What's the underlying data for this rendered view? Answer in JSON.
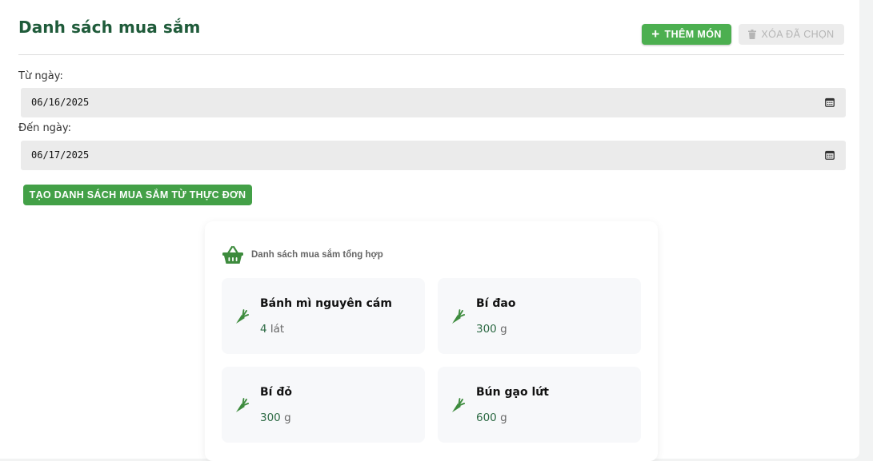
{
  "header": {
    "title": "Danh sách mua sắm",
    "add_label": "THÊM MÓN",
    "delete_label": "XÓA ĐÃ CHỌN"
  },
  "filters": {
    "from_label": "Từ ngày:",
    "from_value": "06/16/2025",
    "to_label": "Đến ngày:",
    "to_value": "06/17/2025"
  },
  "generate_label": "TẠO DANH SÁCH MUA SẮM TỪ THỰC ĐƠN",
  "summary": {
    "title": "Danh sách mua sắm tổng hợp",
    "items": [
      {
        "name": "Bánh mì nguyên cám",
        "qty": "4",
        "unit": "lát"
      },
      {
        "name": "Bí đao",
        "qty": "300",
        "unit": "g"
      },
      {
        "name": "Bí đỏ",
        "qty": "300",
        "unit": "g"
      },
      {
        "name": "Bún gạo lứt",
        "qty": "600",
        "unit": "g"
      }
    ]
  },
  "colors": {
    "title": "#1f5b3a",
    "primary": "#4caf50",
    "veg_icon": "#3d8b3d"
  },
  "icons": {
    "add": "plus-icon",
    "delete": "trash-icon",
    "date": "calendar-icon",
    "summary": "basket-icon",
    "item": "carrot-icon"
  }
}
